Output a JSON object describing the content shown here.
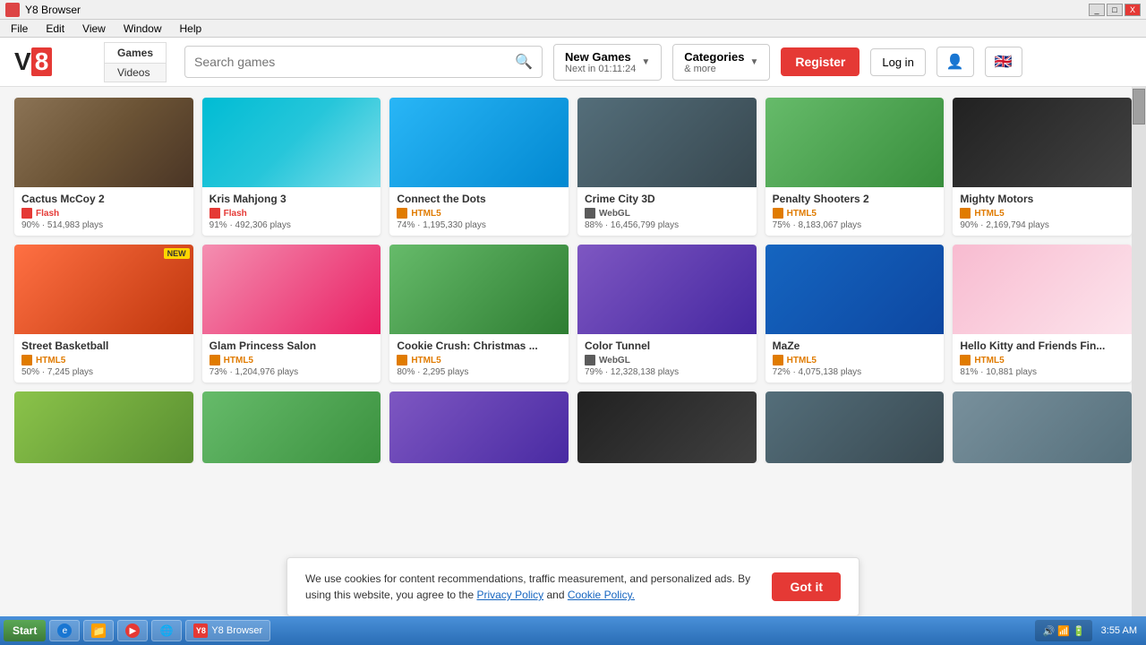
{
  "window": {
    "title": "Y8 Browser",
    "controls": [
      "_",
      "□",
      "X"
    ]
  },
  "menubar": {
    "items": [
      "File",
      "Edit",
      "View",
      "Window",
      "Help"
    ]
  },
  "nav": {
    "logo_v": "V",
    "logo_8": "8",
    "tabs": {
      "games": "Games",
      "videos": "Videos"
    },
    "search_placeholder": "Search games",
    "new_games_label": "New Games",
    "new_games_timer": "Next in 01:11:24",
    "categories_label": "Categories",
    "categories_more": "& more",
    "register": "Register",
    "login": "Log in"
  },
  "games_row1": [
    {
      "title": "Cactus McCoy 2",
      "tech": "Flash",
      "tech_type": "flash",
      "rating": "90%",
      "plays": "514,983 plays",
      "thumb_class": "thumb-cactus"
    },
    {
      "title": "Kris Mahjong 3",
      "tech": "Flash",
      "tech_type": "flash",
      "rating": "91%",
      "plays": "492,306 plays",
      "thumb_class": "thumb-mahjong"
    },
    {
      "title": "Connect the Dots",
      "tech": "HTML5",
      "tech_type": "html5",
      "rating": "74%",
      "plays": "1,195,330 plays",
      "thumb_class": "thumb-dots"
    },
    {
      "title": "Crime City 3D",
      "tech": "WebGL",
      "tech_type": "webgl",
      "rating": "88%",
      "plays": "16,456,799 plays",
      "thumb_class": "thumb-crime"
    },
    {
      "title": "Penalty Shooters 2",
      "tech": "HTML5",
      "tech_type": "html5",
      "rating": "75%",
      "plays": "8,183,067 plays",
      "thumb_class": "thumb-penalty"
    },
    {
      "title": "Mighty Motors",
      "tech": "HTML5",
      "tech_type": "html5",
      "rating": "90%",
      "plays": "2,169,794 plays",
      "thumb_class": "thumb-mighty"
    }
  ],
  "games_row2": [
    {
      "title": "Street Basketball",
      "tech": "HTML5",
      "tech_type": "html5",
      "rating": "50%",
      "plays": "7,245 plays",
      "thumb_class": "thumb-basketball",
      "badge": "NEW"
    },
    {
      "title": "Glam Princess Salon",
      "tech": "HTML5",
      "tech_type": "html5",
      "rating": "73%",
      "plays": "1,204,976 plays",
      "thumb_class": "thumb-glam"
    },
    {
      "title": "Cookie Crush: Christmas ...",
      "tech": "HTML5",
      "tech_type": "html5",
      "rating": "80%",
      "plays": "2,295 plays",
      "thumb_class": "thumb-cookie"
    },
    {
      "title": "Color Tunnel",
      "tech": "WebGL",
      "tech_type": "webgl",
      "rating": "79%",
      "plays": "12,328,138 plays",
      "thumb_class": "thumb-tunnel"
    },
    {
      "title": "MaZe",
      "tech": "HTML5",
      "tech_type": "html5",
      "rating": "72%",
      "plays": "4,075,138 plays",
      "thumb_class": "thumb-maze"
    },
    {
      "title": "Hello Kitty and Friends Fin...",
      "tech": "HTML5",
      "tech_type": "html5",
      "rating": "81%",
      "plays": "10,881 plays",
      "thumb_class": "thumb-kitty"
    }
  ],
  "cookie_banner": {
    "text": "We use cookies for content recommendations, traffic measurement, and personalized ads. By using this website, you agree to the",
    "privacy_link": "Privacy Policy",
    "and": "and",
    "cookie_link": "Cookie Policy.",
    "button": "Got it"
  },
  "taskbar": {
    "start": "Start",
    "items": [
      "IE",
      "Folder",
      "Media",
      "Chrome",
      "V8",
      "Browser"
    ],
    "time": "3:55 AM"
  }
}
